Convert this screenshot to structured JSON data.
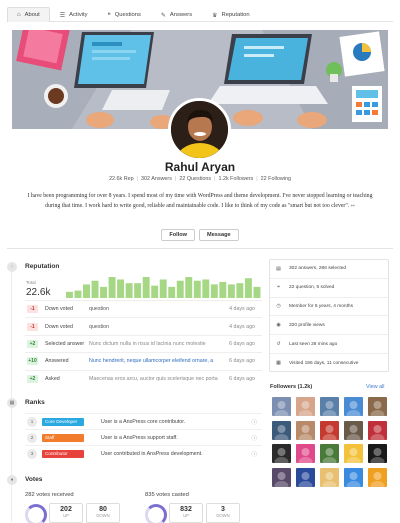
{
  "tabs": [
    {
      "label": "About",
      "icon": "home-icon",
      "active": true
    },
    {
      "label": "Activity",
      "icon": "activity-icon"
    },
    {
      "label": "Questions",
      "icon": "questions-icon"
    },
    {
      "label": "Answers",
      "icon": "answers-icon"
    },
    {
      "label": "Reputation",
      "icon": "trophy-icon"
    }
  ],
  "profile": {
    "name": "Rahul Aryan",
    "stats": [
      "22.6k Rep",
      "302 Answers",
      "22 Questions",
      "1.2k Followers",
      "22 Following"
    ],
    "bio": "I have been programming for over 8 years. I spend most of my time with WordPress and theme development. I've never stopped learning or teaching during that time. I work hard to write good, reliable and maintainable code. I like to think of my code as \"smart but not too clever\".",
    "follow_label": "Follow",
    "message_label": "Message"
  },
  "reputation": {
    "title": "Reputation",
    "total_label": "Total",
    "total": "22.6k",
    "chart_values": [
      5,
      6,
      11,
      14,
      9,
      17,
      15,
      12,
      12,
      17,
      10,
      15,
      9,
      14,
      17,
      14,
      15,
      11,
      13,
      11,
      12,
      16,
      9
    ],
    "bar_color": "#a6d785",
    "rows": [
      {
        "points": "-1",
        "kind": "neg",
        "action": "Down voted",
        "ref": "question",
        "ref_style": "plain",
        "when": "4 days ago"
      },
      {
        "points": "-1",
        "kind": "neg",
        "action": "Down voted",
        "ref": "question",
        "ref_style": "plain",
        "when": "4 days ago"
      },
      {
        "points": "+2",
        "kind": "pos",
        "action": "Selected answer",
        "ref": "Nunc dictum nulla in risus id lacinia nunc molestie",
        "ref_style": "muted",
        "when": "6 days ago"
      },
      {
        "points": "+10",
        "kind": "pos",
        "action": "Answered",
        "ref": "Nunc hendrerit, neque ullamcorper eleifend ornare, a",
        "ref_style": "link",
        "when": "6 days ago"
      },
      {
        "points": "+2",
        "kind": "pos",
        "action": "Asked",
        "ref": "Maecenas eros arcu, auctor quis scelerisque nec porta",
        "ref_style": "muted",
        "when": "6 days ago"
      }
    ]
  },
  "ranks": {
    "title": "Ranks",
    "items": [
      {
        "num": "1",
        "badge": "Core Developer",
        "color": "#29a9e0",
        "desc": "User is a AnsPress core contributor."
      },
      {
        "num": "2",
        "badge": "Staff",
        "color": "#f07c2c",
        "desc": "User is a AnsPress support staff."
      },
      {
        "num": "3",
        "badge": "Contributor",
        "color": "#e8423c",
        "desc": "User contributed in AnsPress development."
      }
    ]
  },
  "votes": {
    "title": "Votes",
    "received_label": "282 votes received",
    "casted_label": "835 votes casted",
    "received": {
      "up": "202",
      "down": "80"
    },
    "casted": {
      "up": "832",
      "down": "3"
    },
    "up_label": "UP",
    "down_label": "DOWN"
  },
  "sidebar": {
    "rows": [
      {
        "icon": "answers-icon",
        "text": "302 answers, 286 selected"
      },
      {
        "icon": "question-icon",
        "text": "22 question, 6 solved"
      },
      {
        "icon": "clock-icon",
        "text": "Member for 6 years, 4 months"
      },
      {
        "icon": "eye-icon",
        "text": "320 profile views"
      },
      {
        "icon": "history-icon",
        "text": "Last seen 28 mins ago"
      },
      {
        "icon": "calendar-icon",
        "text": "Visited 186 days, 11 consecutive"
      }
    ],
    "followers_title": "Followers (1.2k)",
    "view_all": "View all",
    "followers": [
      "#7c8fb0",
      "#d6a58a",
      "#5a7fa8",
      "#4a8cd4",
      "#8a6a4a",
      "#3c5a7a",
      "#b88a6a",
      "#c43a2e",
      "#6a5a4a",
      "#c0303a",
      "#2a2a2a",
      "#e04a8a",
      "#4a7a3a",
      "#f4c23a",
      "#1a1a1a",
      "#5a4a6a",
      "#2a4a9a",
      "#e8c070",
      "#3a8ae0",
      "#f0a020"
    ]
  }
}
